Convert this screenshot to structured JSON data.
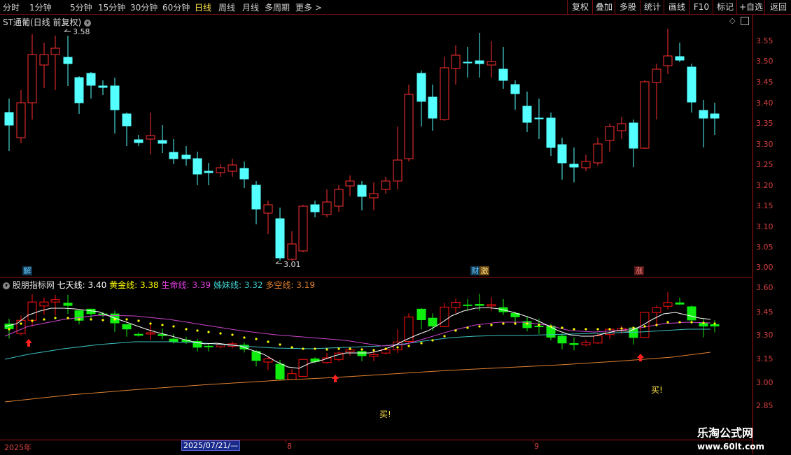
{
  "toolbar": {
    "periods": [
      "分时",
      "1分钟",
      "5分钟",
      "15分钟",
      "30分钟",
      "60分钟",
      "日线",
      "周线",
      "月线",
      "多周期",
      "更多 >"
    ],
    "active_period": "日线",
    "buttons": [
      "复权",
      "叠加",
      "多股",
      "统计",
      "画线",
      "F10",
      "标记",
      "+自选",
      "返回"
    ]
  },
  "stock": {
    "title": "ST通葡(日线 前复权)",
    "high_mark": "3.58",
    "low_mark": "3.01"
  },
  "price_axis": [
    "3.55",
    "3.50",
    "3.45",
    "3.40",
    "3.35",
    "3.30",
    "3.25",
    "3.20",
    "3.15",
    "3.10",
    "3.05",
    "3.00"
  ],
  "events": {
    "e1": "解",
    "e2": "财",
    "e3": "激",
    "e4": "涨"
  },
  "indicator": {
    "name": "股朋指标网",
    "l1_label": "七天线:",
    "l1_value": "3.40",
    "l2_label": "黄金线:",
    "l2_value": "3.38",
    "l3_label": "生命线:",
    "l3_value": "3.39",
    "l4_label": "姊妹线:",
    "l4_value": "3.32",
    "l5_label": "多空线:",
    "l5_value": "3.19",
    "axis": [
      "3.60",
      "3.45",
      "3.30",
      "3.15",
      "3.00",
      "2.85"
    ],
    "buy_label": "买!"
  },
  "dates": {
    "year": "2025年",
    "cursor": "2025/07/21/—",
    "m8": "8",
    "m9": "9"
  },
  "watermark": {
    "line1": "乐淘公式网",
    "line2": "www.60lt.com"
  },
  "colors": {
    "up": "#ff3030",
    "down": "#54ffff",
    "bg": "#000000",
    "active": "#ffe24a",
    "l1": "#ffffff",
    "l2": "#ffff00",
    "l3": "#cc44cc",
    "l4": "#3ec0c0",
    "l5": "#e08030",
    "ind_up": "#ff1010",
    "ind_down": "#10ee10"
  }
}
